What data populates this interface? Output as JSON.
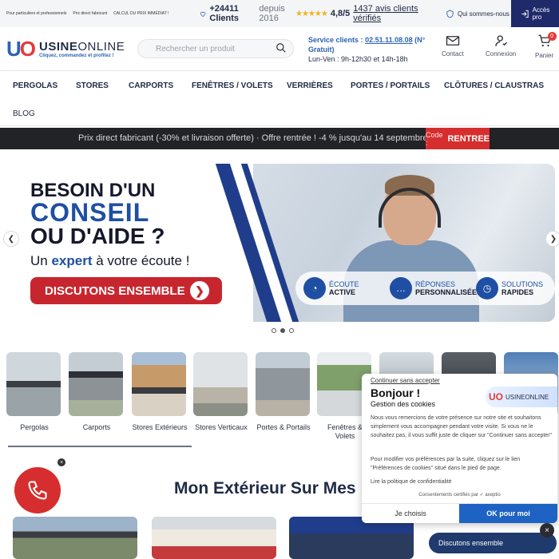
{
  "topbar": {
    "links": [
      "Pour particuliers et professionnels",
      "Prix direct fabricant",
      "CALCUL DU PRIX IMMÉDIAT !"
    ],
    "clients_count": "+24411 Clients",
    "clients_since": "depuis 2016",
    "stars": "★★★★★",
    "rating": "4,8/5",
    "reviews_link": "1437 avis clients vérifiés",
    "who_link": "Qui sommes-nous",
    "pro_label_1": "Accès",
    "pro_label_2": "pro"
  },
  "header": {
    "logo_mark_u": "U",
    "logo_mark_o": "O",
    "logo_name_bold": "USINE",
    "logo_name": "ONLINE",
    "logo_tagline": "Cliquez, commandez et profitez !",
    "search_placeholder": "Rechercher un produit",
    "service_label": "Service clients :",
    "service_phone": "02.51.11.08.08",
    "service_note": "(N° Gratuit)",
    "service_hours": "Lun-Ven : 9h-12h30 et 14h-18h",
    "contact_label": "Contact",
    "login_label": "Connexion",
    "cart_label": "Panier",
    "cart_count": "0"
  },
  "nav": {
    "items": [
      "PERGOLAS",
      "STORES",
      "CARPORTS",
      "FENÊTRES / VOLETS",
      "VERRIÈRES",
      "PORTES / PORTAILS",
      "CLÔTURES / CLAUSTRAS"
    ],
    "blog": "BLOG"
  },
  "promo": {
    "text": "Prix direct fabricant (-30% et livraison offerte) · Offre rentrée ! -4 % jusqu'au 14 septembre",
    "code_label": "Code :",
    "code_value": "RENTREE"
  },
  "banner": {
    "line1": "BESOIN D'UN",
    "line2": "CONSEIL",
    "line3": "OU D'AIDE ?",
    "sub_pre": "Un",
    "sub_em": "expert",
    "sub_post": "à votre écoute !",
    "cta": "DISCUTONS ENSEMBLE",
    "features": [
      {
        "l1": "ÉCOUTE",
        "l2": "ACTIVE"
      },
      {
        "l1": "RÉPONSES",
        "l2": "PERSONNALISÉES"
      },
      {
        "l1": "SOLUTIONS",
        "l2": "RAPIDES"
      }
    ]
  },
  "categories": [
    {
      "label": "Pergolas"
    },
    {
      "label": "Carports"
    },
    {
      "label": "Stores Extérieurs"
    },
    {
      "label": "Stores Verticaux"
    },
    {
      "label": "Portes & Portails"
    },
    {
      "label": "Fenêtres & Volets"
    }
  ],
  "section_title": "Mon Extérieur Sur Mes",
  "cookie": {
    "continue_link": "Continuer sans accepter",
    "title": "Bonjour !",
    "subtitle": "Gestion des cookies",
    "logo_mark": "UO",
    "logo_name": "USINEONLINE",
    "para1": "Nous vous remercions de votre présence sur notre site et souhaitons simplement vous accompagner pendant votre visite. Si vous ne le souhaitez pas, il vous suffit juste de cliquer sur \"Continuer sans accepter\"",
    "para2": "Pour modifier vos préférences par la suite, cliquez sur le lien \"Préférences de cookies\" situé dans le pied de page.",
    "policy_link": "Lire la politique de confidentialité",
    "certified": "Consentements certifiés par ✓ axeptio",
    "btn_choose": "Je choisis",
    "btn_ok": "OK pour moi"
  },
  "chat": {
    "label": "Discutons ensemble"
  },
  "colors": {
    "brand_blue": "#2b63b6",
    "brand_red": "#e23a3a",
    "dark_navy": "#1f2a44",
    "promo_red": "#d62e2e",
    "cookie_ok": "#1e63c4"
  }
}
